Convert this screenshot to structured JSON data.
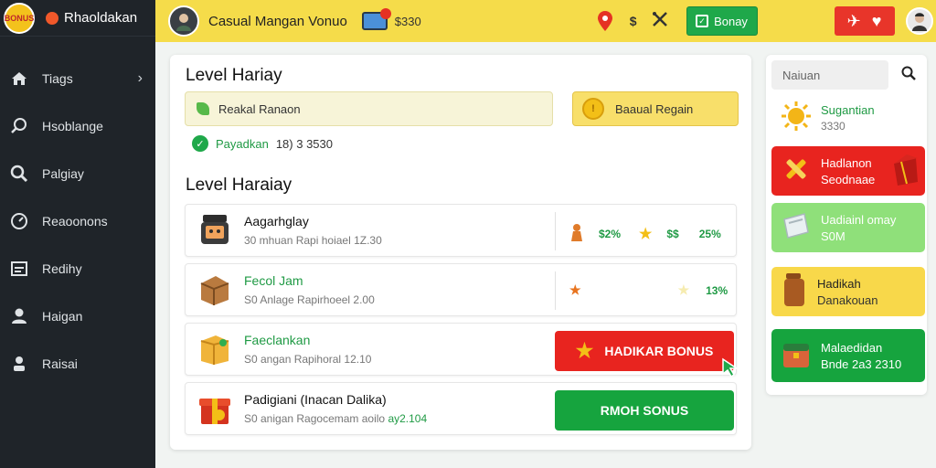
{
  "brand": {
    "logo_text": "BONUS",
    "name": "Rhaoldakan"
  },
  "sidebar": {
    "items": [
      {
        "label": "Tiags",
        "icon": "home-icon",
        "has_chevron": true
      },
      {
        "label": "Hsoblange",
        "icon": "search-icon"
      },
      {
        "label": "Palgiay",
        "icon": "magnifier-icon"
      },
      {
        "label": "Reaoonons",
        "icon": "gauge-icon"
      },
      {
        "label": "Redihy",
        "icon": "window-icon"
      },
      {
        "label": "Haigan",
        "icon": "user-icon"
      },
      {
        "label": "Raisai",
        "icon": "account-icon"
      }
    ]
  },
  "header": {
    "title": "Casual Mangan Vonuo",
    "balance": "$330",
    "dollar_label": "$",
    "bonus_button": "Bonay"
  },
  "main": {
    "section1_title": "Level Hariay",
    "search_text": "Reakal Ranaon",
    "gold_button": "Baaual Regain",
    "status_label": "Payadkan",
    "status_value": "18) 3 3530",
    "section2_title": "Level Haraiay",
    "rows": [
      {
        "name": "Aagarhglay",
        "sub": "30 mhuan Rapi hoiael 1Z.30",
        "stat1": "$2%",
        "stat2": "$$",
        "stat3": "25%"
      },
      {
        "name": "Fecol Jam",
        "sub": "S0 Anlage Rapirhoeel 2.00",
        "stat3": "13%"
      },
      {
        "name": "Faeclankan",
        "sub": "S0 angan Rapihoral 12.10",
        "button": "HADIKAR BONUS"
      },
      {
        "name": "Padigiani (Inacan Dalika)",
        "sub": "S0 anigan Ragocemam aoilo",
        "sub_highlight": "ay2.104",
        "button": "RMOH SONUS"
      }
    ]
  },
  "right_panel": {
    "search_placeholder": "Naiuan",
    "cards": [
      {
        "title": "Sugantian",
        "sub": "3330",
        "bg": "#ffffff",
        "title_color": "#1f9a44"
      },
      {
        "title": "Hadlanon",
        "sub": "Seodnaae",
        "bg": "#e8241f",
        "title_color": "#ffffff"
      },
      {
        "title": "Uadiainl omay",
        "sub": "S0M",
        "bg": "#8fe07a",
        "title_color": "#ffffff"
      },
      {
        "title": "Hadikah",
        "sub": "Danakouan",
        "bg": "#f8d84a",
        "title_color": "#222222"
      },
      {
        "title": "Malaedidan",
        "sub": "Bnde 2a3 2310",
        "bg": "#16a43e",
        "title_color": "#ffffff"
      }
    ]
  }
}
